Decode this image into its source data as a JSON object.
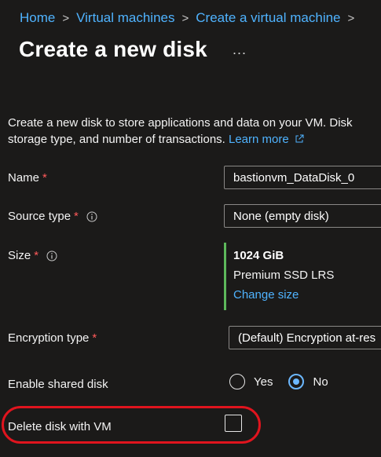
{
  "breadcrumb": {
    "items": [
      "Home",
      "Virtual machines",
      "Create a virtual machine"
    ],
    "separator": ">"
  },
  "page": {
    "title": "Create a new disk",
    "more_icon": "ellipsis-icon",
    "more_label": "..."
  },
  "description": {
    "line1": "Create a new disk to store applications and data on your VM. Disk",
    "line2": "storage type, and number of transactions.",
    "learn_more": "Learn more",
    "learn_more_icon": "external-link-icon"
  },
  "form": {
    "name": {
      "label": "Name",
      "required_mark": "*",
      "value": "bastionvm_DataDisk_0"
    },
    "source_type": {
      "label": "Source type",
      "required_mark": "*",
      "info_icon": "info-icon",
      "value": "None (empty disk)"
    },
    "size": {
      "label": "Size",
      "required_mark": "*",
      "info_icon": "info-icon",
      "value": "1024 GiB",
      "sku": "Premium SSD LRS",
      "change_link": "Change size"
    },
    "encryption_type": {
      "label": "Encryption type",
      "required_mark": "*",
      "value": "(Default) Encryption at-res"
    },
    "enable_shared_disk": {
      "label": "Enable shared disk",
      "options": [
        "Yes",
        "No"
      ],
      "selected": "No"
    },
    "delete_with_vm": {
      "label": "Delete disk with VM",
      "checked": false
    }
  },
  "colors": {
    "background": "#1b1a19",
    "link": "#4fb3ff",
    "required": "#ff5a5a",
    "size_accent": "#5db85b",
    "radio_selected": "#6cb8ff",
    "highlight": "#e0141e"
  }
}
